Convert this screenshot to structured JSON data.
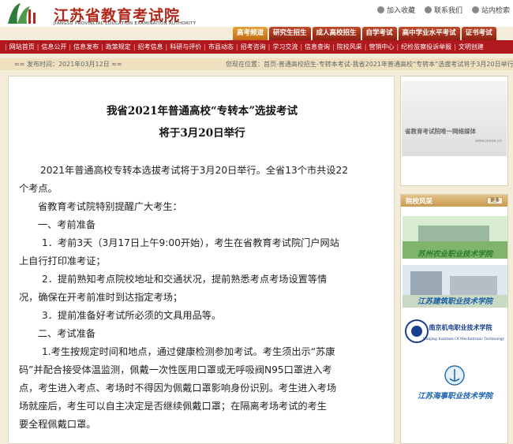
{
  "header": {
    "logo_cn": "江苏省教育考试院",
    "logo_en": "JIANGSU PROVINCIAL EDUCATION EXAMINATION AUTHORITY",
    "tools": [
      "加入收藏",
      "联系我们",
      "站内检索"
    ]
  },
  "tabs": [
    "高考频道",
    "研究生招生",
    "成人高校招生",
    "自学考试",
    "高中学业水平考试",
    "证书考试"
  ],
  "nav": [
    "网站首页",
    "信息公开",
    "信息发布",
    "政策规定",
    "招考信息",
    "科研与评价",
    "市县动态",
    "招考咨询",
    "学习交流",
    "信息查询",
    "院校风采",
    "营销中心",
    "纪检监察投诉举报",
    "文明创建"
  ],
  "infobar": {
    "publish": "≈≈ 发布时间：2021年03月12日 ≈≈",
    "breadcrumb": "您现在位置：首页-普通高校招生-专转本考试-我省2021年普通高校“专转本”选拔考试将于3月20日举行"
  },
  "article": {
    "title_line1": "我省2021年普通高校“专转本”选拔考试",
    "title_line2": "将于3月20日举行",
    "p1a": "2021年普通高校专转本选拔考试将于3月20日举行。全省13个市共设22",
    "p1b": "个考点。",
    "p2": "省教育考试院特别提醒广大考生：",
    "h1": "一、考前准备",
    "p3a": "1．考前3天（3月17日上午9:00开始），考生在省教育考试院门户网站",
    "p3b": "上自行打印准考证；",
    "p4a": "2．提前熟知考点院校地址和交通状况，提前熟悉考点考场设置等情",
    "p4b": "况，确保在开考前准时到达指定考场；",
    "p5": "3．提前准备好考试所必须的文具用品等。",
    "h2": "二、考试准备",
    "p6a": "1.考生按规定时间和地点，通过健康检测参加考试。考生须出示“苏康",
    "p6b": "码”并配合接受体温监测，佩戴一次性医用口罩或无呼吸阀N95口罩进入考",
    "p6c": "点，考生进入考点、考场时不得因为佩戴口罩影响身份识别。考生进入考场",
    "p6d": "场就座后，考生可以自主决定是否继续佩戴口罩；在隔离考场考试的考生",
    "p6e": "要全程佩戴口罩。"
  },
  "sidebar": {
    "banner_text": "省教育考试院唯一网络媒体",
    "banner_url": "www.jseea.cn",
    "section_title": "院校风采",
    "more_label": "更多",
    "schools": [
      "苏州农业职业技术学院",
      "江苏建筑职业技术学院",
      "南京机电职业技术学院",
      "江苏海事职业技术学院"
    ],
    "school3_en": "Nanjing Institute Of Mechatronic Technology"
  },
  "colors": {
    "brand_red": "#b1181d",
    "tab_orange": "#d98a25",
    "page_bg": "#f3ecd9"
  }
}
